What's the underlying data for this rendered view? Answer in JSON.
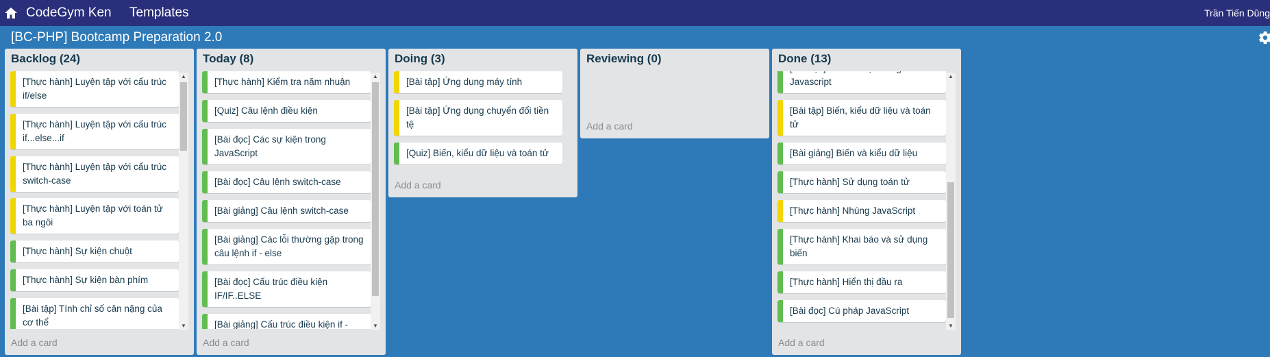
{
  "topbar": {
    "home_icon": "home-icon",
    "brand": "CodeGym Ken",
    "templates": "Templates",
    "user": "Trần Tiến Dũng"
  },
  "board": {
    "title": "[BC-PHP] Bootcamp Preparation 2.0",
    "settings_icon": "gear-icon"
  },
  "colors": {
    "topbar": "#2a2f7b",
    "board_background": "#2e7ab8",
    "list_background": "#e2e4e6",
    "label_yellow": "#f2d600",
    "label_green": "#61bd4f"
  },
  "add_card_label": "Add a card",
  "lists": [
    {
      "title": "Backlog (24)",
      "cards": [
        {
          "text": "[Thực hành] Luyện tập với cấu trúc if/else",
          "label": "yellow"
        },
        {
          "text": "[Thực hành] Luyện tập với cấu trúc if...else...if",
          "label": "yellow"
        },
        {
          "text": "[Thực hành] Luyện tập với cấu trúc switch-case",
          "label": "yellow"
        },
        {
          "text": "[Thực hành] Luyện tập với toán tử ba ngôi",
          "label": "yellow"
        },
        {
          "text": "[Thực hành] Sự kiện chuột",
          "label": "green"
        },
        {
          "text": "[Thực hành] Sự kiện bàn phím",
          "label": "green"
        },
        {
          "text": "[Bài tập] Tính chỉ số cân nặng của cơ thể",
          "label": "green"
        }
      ]
    },
    {
      "title": "Today (8)",
      "cards": [
        {
          "text": "[Thực hành] Kiểm tra năm nhuận",
          "label": "green"
        },
        {
          "text": "[Quiz] Câu lệnh điều kiện",
          "label": "green"
        },
        {
          "text": "[Bài đọc] Các sự kiện trong JavaScript",
          "label": "green"
        },
        {
          "text": "[Bài đọc] Câu lệnh switch-case",
          "label": "green"
        },
        {
          "text": "[Bài giảng] Câu lệnh switch-case",
          "label": "green"
        },
        {
          "text": "[Bài giảng] Các lỗi thường gặp trong câu lệnh if - else",
          "label": "green"
        },
        {
          "text": "[Bài đọc] Cấu trúc điều kiện IF/IF..ELSE",
          "label": "green"
        },
        {
          "text": "[Bài giảng] Cấu trúc điều kiện if - else",
          "label": "green"
        }
      ]
    },
    {
      "title": "Doing (3)",
      "cards": [
        {
          "text": "[Bài tập] Ứng dụng máy tính",
          "label": "yellow"
        },
        {
          "text": "[Bài tập] Ứng dụng chuyển đổi tiền tệ",
          "label": "yellow"
        },
        {
          "text": "[Quiz] Biến, kiểu dữ liệu và toán tử",
          "label": "green"
        }
      ]
    },
    {
      "title": "Reviewing (0)",
      "cards": []
    },
    {
      "title": "Done (13)",
      "cards": [
        {
          "text": "[Bài đọc] Kiểu dữ liệu trong Javascript",
          "label": "green"
        },
        {
          "text": "[Bài tập] Biến, kiểu dữ liệu và toán tử",
          "label": "yellow"
        },
        {
          "text": "[Bài giảng] Biến và kiểu dữ liệu",
          "label": "green"
        },
        {
          "text": "[Thực hành] Sử dụng toán tử",
          "label": "green"
        },
        {
          "text": "[Thực hành] Nhúng JavaScript",
          "label": "yellow"
        },
        {
          "text": "[Thực hành] Khai báo và sử dụng biến",
          "label": "green"
        },
        {
          "text": "[Thực hành] Hiển thị đầu ra",
          "label": "green"
        },
        {
          "text": "[Bài đọc] Cú pháp JavaScript",
          "label": "green"
        }
      ]
    }
  ]
}
